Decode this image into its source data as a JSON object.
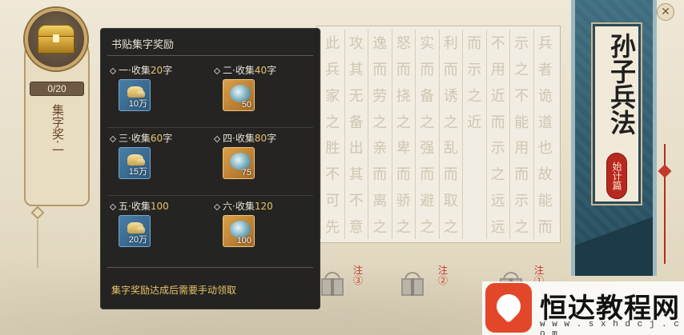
{
  "progress": {
    "text": "0/20",
    "fraction": 0.0
  },
  "left_label": "集字奖·一",
  "tooltip": {
    "title": "书贴集字奖励",
    "rewards": [
      {
        "prefix": "一·收集",
        "count": "20",
        "suffix": "字",
        "item": "silver-ingot",
        "qty": "10万"
      },
      {
        "prefix": "二·收集",
        "count": "40",
        "suffix": "字",
        "item": "jade-swirl",
        "qty": "50"
      },
      {
        "prefix": "三·收集",
        "count": "60",
        "suffix": "字",
        "item": "silver-ingot",
        "qty": "15万"
      },
      {
        "prefix": "四·收集",
        "count": "80",
        "suffix": "字",
        "item": "jade-swirl",
        "qty": "75"
      },
      {
        "prefix": "五·收集",
        "count": "100",
        "suffix": "",
        "item": "silver-ingot",
        "qty": "20万"
      },
      {
        "prefix": "六·收集",
        "count": "120",
        "suffix": "",
        "item": "jade-swirl",
        "qty": "100"
      }
    ],
    "footer": "集字奖励达成后需要手动领取"
  },
  "grid_columns": [
    [
      "兵",
      "者",
      "诡",
      "道",
      "也",
      "故",
      "能",
      "而"
    ],
    [
      "示",
      "之",
      "不",
      "能",
      "用",
      "而",
      "示",
      "之"
    ],
    [
      "不",
      "用",
      "近",
      "而",
      "示",
      "之",
      "远",
      "远"
    ],
    [
      "而",
      "示",
      "之",
      "近",
      "",
      "",
      "",
      ""
    ],
    [
      "利",
      "而",
      "诱",
      "之",
      "乱",
      "而",
      "取",
      "之"
    ],
    [
      "实",
      "而",
      "备",
      "之",
      "强",
      "而",
      "避",
      "之"
    ],
    [
      "怒",
      "而",
      "挠",
      "之",
      "卑",
      "而",
      "骄",
      "之"
    ],
    [
      "逸",
      "而",
      "劳",
      "之",
      "亲",
      "而",
      "离",
      "之"
    ],
    [
      "攻",
      "其",
      "无",
      "备",
      "出",
      "其",
      "不",
      "意"
    ],
    [
      "此",
      "兵",
      "家",
      "之",
      "胜",
      "不",
      "可",
      "先"
    ]
  ],
  "gift_notes": [
    "注③",
    "注②",
    "注①"
  ],
  "scroll": {
    "title": "孙子兵法",
    "seal": "始计篇"
  },
  "watermark": {
    "text": "恒达教程网",
    "url": "w w w . s x h d c j . c o m"
  },
  "colors": {
    "accent_gold": "#e6c36a",
    "seal_red": "#b8281e",
    "scroll_blue": "#2f5a6c"
  }
}
